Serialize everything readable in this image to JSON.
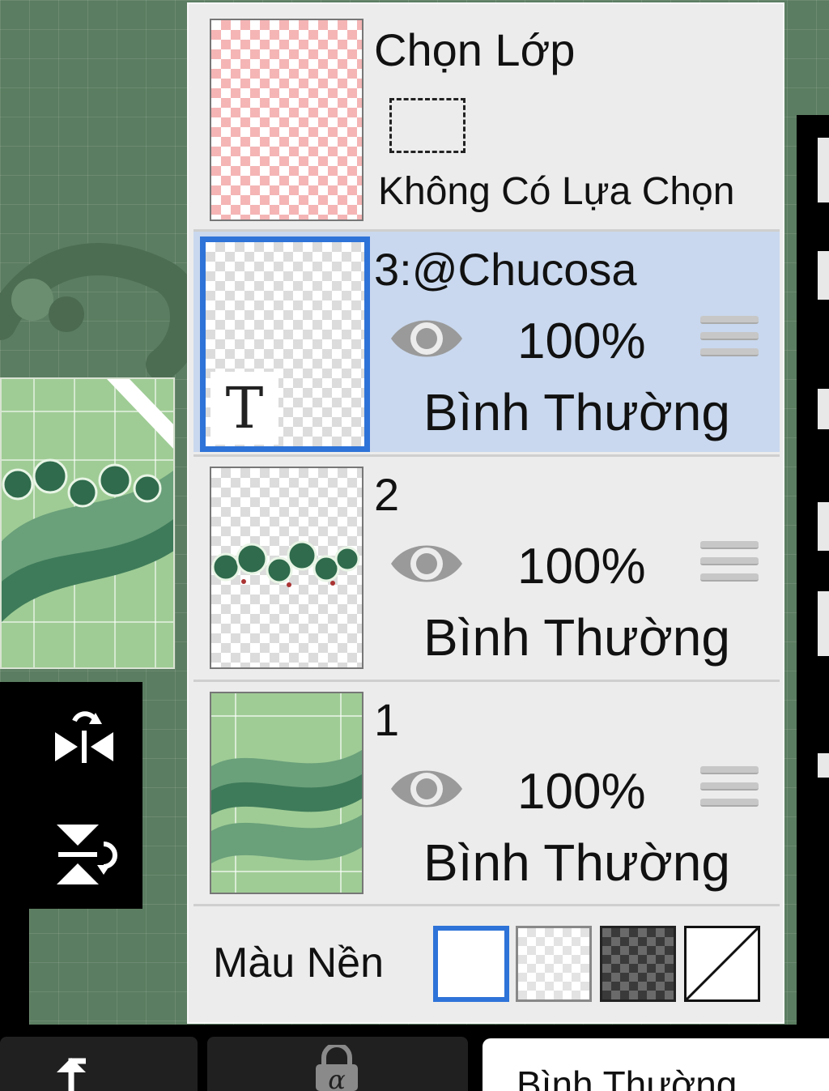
{
  "selection_layer": {
    "title": "Chọn Lớp",
    "status": "Không Có Lựa Chọn"
  },
  "layers": [
    {
      "name": "3:@Chucosa",
      "opacity": "100%",
      "blend": "Bình Thường",
      "selected": true,
      "type": "text",
      "visibility_icon": "eye-icon"
    },
    {
      "name": "2",
      "opacity": "100%",
      "blend": "Bình Thường",
      "selected": false,
      "type": "raster",
      "visibility_icon": "eye-icon"
    },
    {
      "name": "1",
      "opacity": "100%",
      "blend": "Bình Thường",
      "selected": false,
      "type": "raster",
      "visibility_icon": "eye-icon"
    }
  ],
  "text_layer_badge": "T",
  "background": {
    "label": "Màu Nền",
    "options": [
      "white",
      "light-checker",
      "dark-checker",
      "none"
    ],
    "selected": "white"
  },
  "bottom_bar": {
    "blend_mode": "Bình Thường",
    "alpha_lock_symbol": "α"
  },
  "colors": {
    "selection_highlight": "#c9d8ee",
    "accent_blue": "#2e73d8",
    "panel_bg": "#ececec",
    "canvas_green": "#5b7d61"
  }
}
